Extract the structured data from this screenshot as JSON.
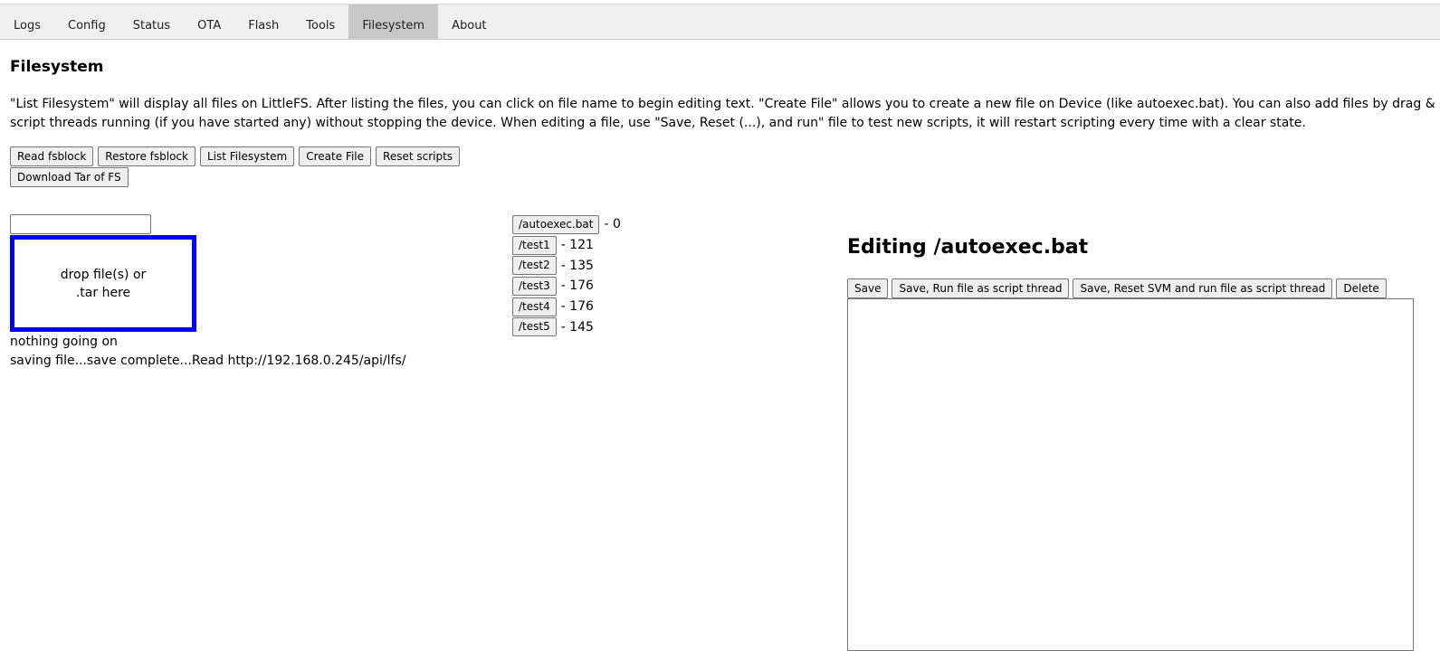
{
  "tabs": [
    {
      "label": "Logs"
    },
    {
      "label": "Config"
    },
    {
      "label": "Status"
    },
    {
      "label": "OTA"
    },
    {
      "label": "Flash"
    },
    {
      "label": "Tools"
    },
    {
      "label": "Filesystem",
      "active": true
    },
    {
      "label": "About"
    }
  ],
  "page": {
    "title": "Filesystem",
    "description_line1": "\"List Filesystem\" will display all files on LittleFS. After listing the files, you can click on file name to begin editing text. \"Create File\" allows you to create a new file on Device (like autoexec.bat). You can also add files by drag & d",
    "description_line2": "script threads running (if you have started any) without stopping the device. When editing a file, use \"Save, Reset (...), and run\" file to test new scripts, it will restart scripting every time with a clear state."
  },
  "actions": {
    "read_fsblock": "Read fsblock",
    "restore_fsblock": "Restore fsblock",
    "list_filesystem": "List Filesystem",
    "create_file": "Create File",
    "reset_scripts": "Reset scripts",
    "download_tar": "Download Tar of FS"
  },
  "upload": {
    "filename_value": "",
    "dropzone_line1": "drop file(s) or",
    "dropzone_line2": ".tar here",
    "status_line1": "nothing going on",
    "status_line2": "saving file...save complete...Read http://192.168.0.245/api/lfs/"
  },
  "files": [
    {
      "name": "/autoexec.bat",
      "size": "- 0"
    },
    {
      "name": "/test1",
      "size": "- 121"
    },
    {
      "name": "/test2",
      "size": "- 135"
    },
    {
      "name": "/test3",
      "size": "- 176"
    },
    {
      "name": "/test4",
      "size": "- 176"
    },
    {
      "name": "/test5",
      "size": "- 145"
    }
  ],
  "editor": {
    "title": "Editing /autoexec.bat",
    "save": "Save",
    "save_run": "Save, Run file as script thread",
    "save_reset_run": "Save, Reset SVM and run file as script thread",
    "delete": "Delete",
    "content": ""
  }
}
